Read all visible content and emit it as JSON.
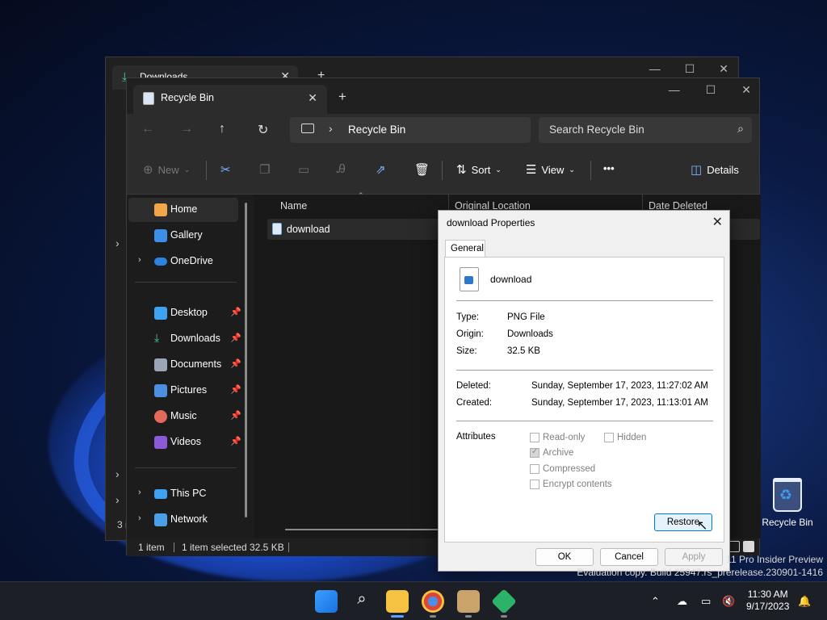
{
  "back_window": {
    "tab_title": "Downloads",
    "status_fragment": "3 i"
  },
  "window": {
    "tab_title": "Recycle Bin",
    "breadcrumb": "Recycle Bin",
    "search_placeholder": "Search Recycle Bin",
    "toolbar": {
      "new_label": "New",
      "sort_label": "Sort",
      "view_label": "View",
      "more_label": "•••",
      "details_label": "Details"
    },
    "sidebar": {
      "home": "Home",
      "gallery": "Gallery",
      "onedrive": "OneDrive",
      "desktop": "Desktop",
      "downloads": "Downloads",
      "documents": "Documents",
      "pictures": "Pictures",
      "music": "Music",
      "videos": "Videos",
      "thispc": "This PC",
      "network": "Network"
    },
    "columns": {
      "name": "Name",
      "original_location": "Original Location",
      "date_deleted": "Date Deleted"
    },
    "files": [
      {
        "name": "download"
      }
    ],
    "status": {
      "count": "1 item",
      "selected": "1 item selected",
      "size": "32.5 KB"
    }
  },
  "dialog": {
    "title": "download Properties",
    "tab": "General",
    "file_name": "download",
    "type_label": "Type:",
    "type_value": "PNG File",
    "origin_label": "Origin:",
    "origin_value": "Downloads",
    "size_label": "Size:",
    "size_value": "32.5 KB",
    "deleted_label": "Deleted:",
    "deleted_value": "Sunday, September 17, 2023, 11:27:02 AM",
    "created_label": "Created:",
    "created_value": "Sunday, September 17, 2023, 11:13:01 AM",
    "attributes_label": "Attributes",
    "attributes": {
      "read_only": "Read-only",
      "hidden": "Hidden",
      "archive": "Archive",
      "compressed": "Compressed",
      "encrypt": "Encrypt contents"
    },
    "restore": "Restore",
    "ok": "OK",
    "cancel": "Cancel",
    "apply": "Apply"
  },
  "desktop": {
    "recycle_bin_label": "Recycle Bin",
    "watermark_line1": "11 Pro Insider Preview",
    "watermark_line2": "Evaluation copy. Build 25947.rs_prerelease.230901-1416"
  },
  "taskbar": {
    "time": "11:30 AM",
    "date": "9/17/2023"
  },
  "colors": {
    "accent": "#0078d4",
    "explorer_bg": "#191919",
    "taskbar_bg": "#1d1f27"
  }
}
